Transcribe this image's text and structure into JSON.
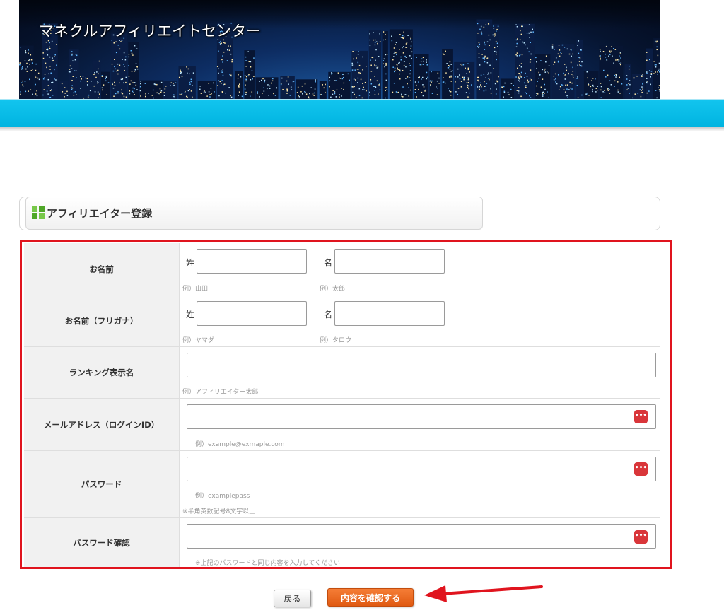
{
  "site": {
    "title": "マネクルアフィリエイトセンター"
  },
  "section": {
    "title": "アフィリエイター登録"
  },
  "form": {
    "name": {
      "label": "お名前",
      "sei_label": "姓",
      "mei_label": "名",
      "sei_example": "例）山田",
      "mei_example": "例）太郎",
      "sei_value": "",
      "mei_value": ""
    },
    "kana": {
      "label": "お名前（フリガナ）",
      "sei_label": "姓",
      "mei_label": "名",
      "sei_example": "例）ヤマダ",
      "mei_example": "例）タロウ",
      "sei_value": "",
      "mei_value": ""
    },
    "ranking": {
      "label": "ランキング表示名",
      "example": "例）アフィリエイター太郎",
      "value": ""
    },
    "email": {
      "label": "メールアドレス（ログインID）",
      "example": "例）example@exmaple.com",
      "value": ""
    },
    "password": {
      "label": "パスワード",
      "example": "例）examplepass",
      "note": "※半角英数記号8文字以上",
      "value": ""
    },
    "password_confirm": {
      "label": "パスワード確認",
      "note": "※上記のパスワードと同じ内容を入力してください",
      "value": ""
    },
    "password_manager_icon": "password-manager-icon"
  },
  "buttons": {
    "back": "戻る",
    "confirm": "内容を確認する"
  },
  "colors": {
    "nav_bar": "#00b4e0",
    "highlight_frame": "#e0141e",
    "confirm_button": "#e8661c",
    "password_icon": "#d9363a"
  }
}
